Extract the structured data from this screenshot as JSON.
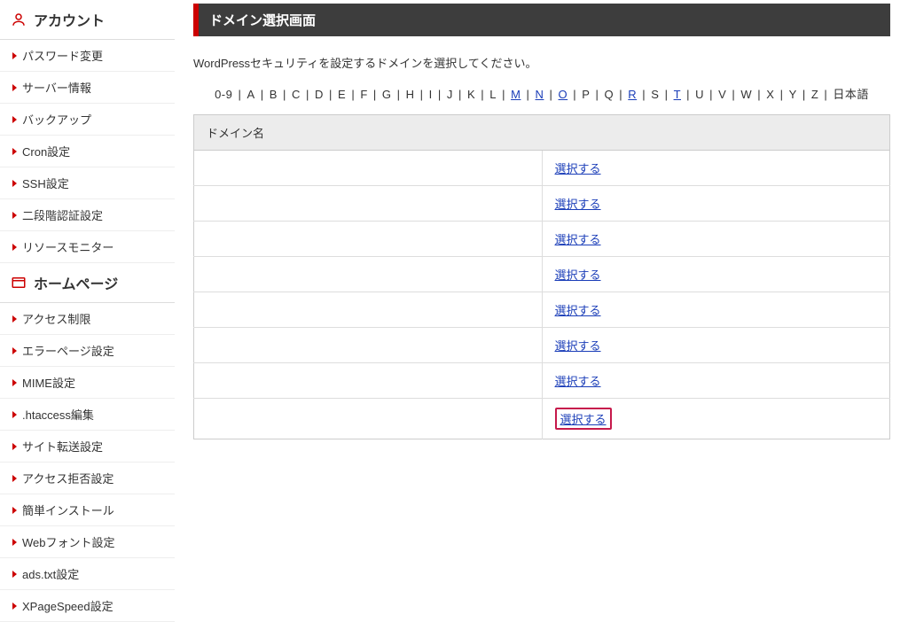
{
  "sidebar": {
    "sections": [
      {
        "id": "account",
        "title": "アカウント",
        "icon": "account",
        "items": [
          {
            "label": "パスワード変更"
          },
          {
            "label": "サーバー情報"
          },
          {
            "label": "バックアップ"
          },
          {
            "label": "Cron設定"
          },
          {
            "label": "SSH設定"
          },
          {
            "label": "二段階認証設定"
          },
          {
            "label": "リソースモニター"
          }
        ]
      },
      {
        "id": "homepage",
        "title": "ホームページ",
        "icon": "homepage",
        "items": [
          {
            "label": "アクセス制限"
          },
          {
            "label": "エラーページ設定"
          },
          {
            "label": "MIME設定"
          },
          {
            "label": ".htaccess編集"
          },
          {
            "label": "サイト転送設定"
          },
          {
            "label": "アクセス拒否設定"
          },
          {
            "label": "簡単インストール"
          },
          {
            "label": "Webフォント設定"
          },
          {
            "label": "ads.txt設定"
          },
          {
            "label": "XPageSpeed設定"
          }
        ]
      }
    ]
  },
  "main": {
    "title": "ドメイン選択画面",
    "instruction": "WordPressセキュリティを設定するドメインを選択してください。",
    "alpha_index": [
      {
        "label": "0-9",
        "link": false
      },
      {
        "label": "A",
        "link": false
      },
      {
        "label": "B",
        "link": false
      },
      {
        "label": "C",
        "link": false
      },
      {
        "label": "D",
        "link": false
      },
      {
        "label": "E",
        "link": false
      },
      {
        "label": "F",
        "link": false
      },
      {
        "label": "G",
        "link": false
      },
      {
        "label": "H",
        "link": false
      },
      {
        "label": "I",
        "link": false
      },
      {
        "label": "J",
        "link": false
      },
      {
        "label": "K",
        "link": false
      },
      {
        "label": "L",
        "link": false
      },
      {
        "label": "M",
        "link": true
      },
      {
        "label": "N",
        "link": true
      },
      {
        "label": "O",
        "link": true
      },
      {
        "label": "P",
        "link": false
      },
      {
        "label": "Q",
        "link": false
      },
      {
        "label": "R",
        "link": true
      },
      {
        "label": "S",
        "link": false
      },
      {
        "label": "T",
        "link": true
      },
      {
        "label": "U",
        "link": false
      },
      {
        "label": "V",
        "link": false
      },
      {
        "label": "W",
        "link": false
      },
      {
        "label": "X",
        "link": false
      },
      {
        "label": "Y",
        "link": false
      },
      {
        "label": "Z",
        "link": false
      },
      {
        "label": "日本語",
        "link": false
      }
    ],
    "table": {
      "header": "ドメイン名",
      "select_label": "選択する",
      "rows": [
        {
          "highlight": false
        },
        {
          "highlight": false
        },
        {
          "highlight": false
        },
        {
          "highlight": false
        },
        {
          "highlight": false
        },
        {
          "highlight": false
        },
        {
          "highlight": false
        },
        {
          "highlight": true
        }
      ]
    }
  }
}
